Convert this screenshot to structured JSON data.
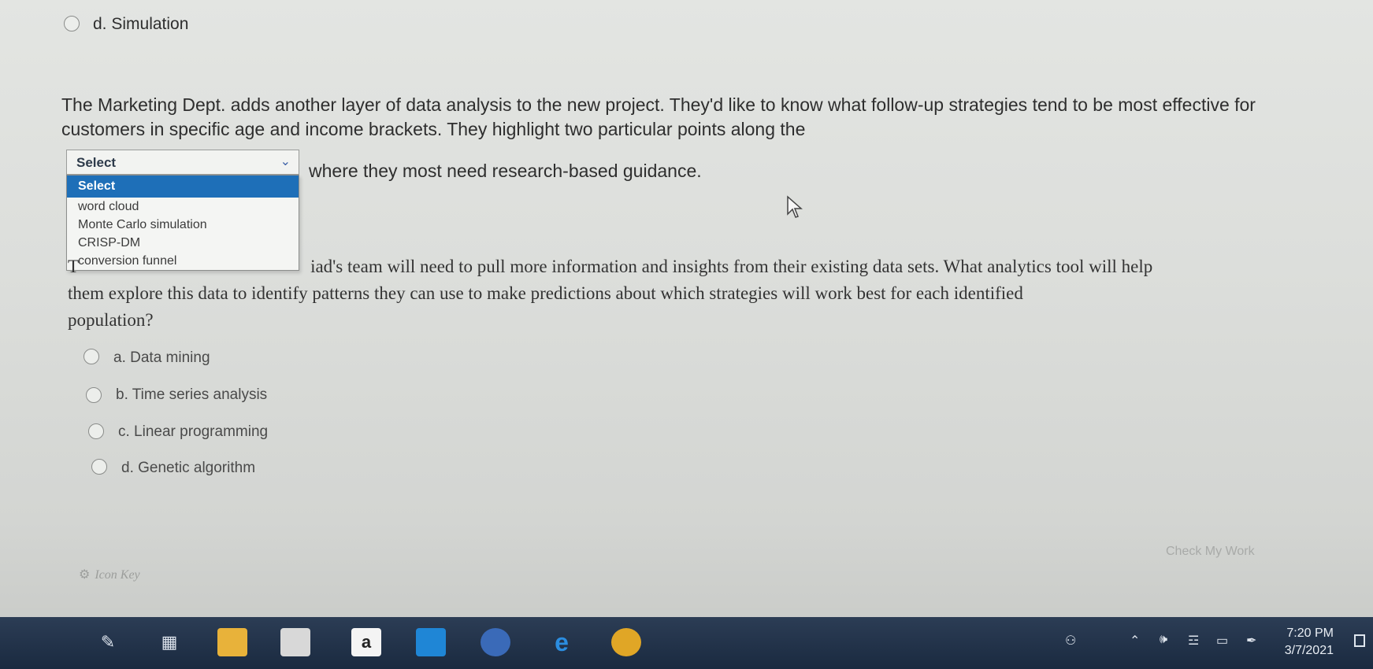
{
  "prev_question": {
    "option_d": "d. Simulation"
  },
  "question1": {
    "text": "The Marketing Dept. adds another layer of data analysis to the new project. They'd like to know what follow-up strategies tend to be most effective for customers in specific age and income brackets. They highlight two particular points along the",
    "after_select": "where they most need research-based guidance.",
    "select": {
      "value": "Select",
      "options": [
        "Select",
        "word cloud",
        "Monte Carlo simulation",
        "CRISP-DM",
        "conversion funnel"
      ],
      "highlighted": "Select"
    }
  },
  "question2": {
    "lead": "T",
    "line1": "iad's team will need to pull more information and insights from their existing data sets. What analytics tool will help",
    "line2": "them explore this data to identify patterns they can use to make predictions about which strategies will work best for each identified",
    "line3": "population?",
    "options": [
      "a. Data mining",
      "b. Time series analysis",
      "c. Linear programming",
      "d. Genetic algorithm"
    ]
  },
  "footer": {
    "check_button": "Check My Work",
    "icon_key": "Icon Key"
  },
  "taskbar": {
    "icons": [
      "windows-ink-icon",
      "task-view-icon",
      "file-explorer-icon",
      "store-icon",
      "amazon-icon",
      "mail-icon",
      "photos-icon",
      "edge-icon",
      "chrome-icon"
    ],
    "amazon_glyph": "a",
    "edge_glyph": "e",
    "time": "7:20 PM",
    "date": "3/7/2021"
  },
  "colors": {
    "accent": "#1e6fb8",
    "taskbar": "#1f2f46"
  }
}
